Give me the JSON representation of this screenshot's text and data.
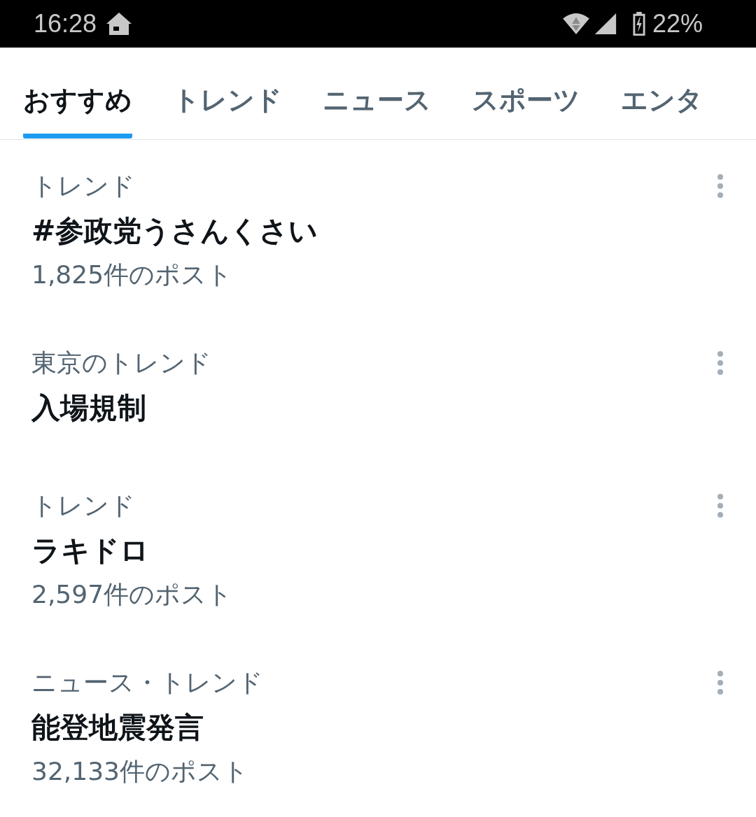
{
  "status_bar": {
    "time": "16:28",
    "battery": "22%"
  },
  "tabs": [
    {
      "label": "おすすめ",
      "selected": true
    },
    {
      "label": "トレンド",
      "selected": false
    },
    {
      "label": "ニュース",
      "selected": false
    },
    {
      "label": "スポーツ",
      "selected": false
    },
    {
      "label": "エンタ",
      "selected": false
    }
  ],
  "trends": [
    {
      "category": "トレンド",
      "title": "#参政党うさんくさい",
      "count": "1,825件のポスト"
    },
    {
      "category": "東京のトレンド",
      "title": "入場規制"
    },
    {
      "category": "トレンド",
      "title": "ラキドロ",
      "count": "2,597件のポスト"
    },
    {
      "category": "ニュース・トレンド",
      "title": "能登地震発言",
      "count": "32,133件のポスト"
    }
  ]
}
